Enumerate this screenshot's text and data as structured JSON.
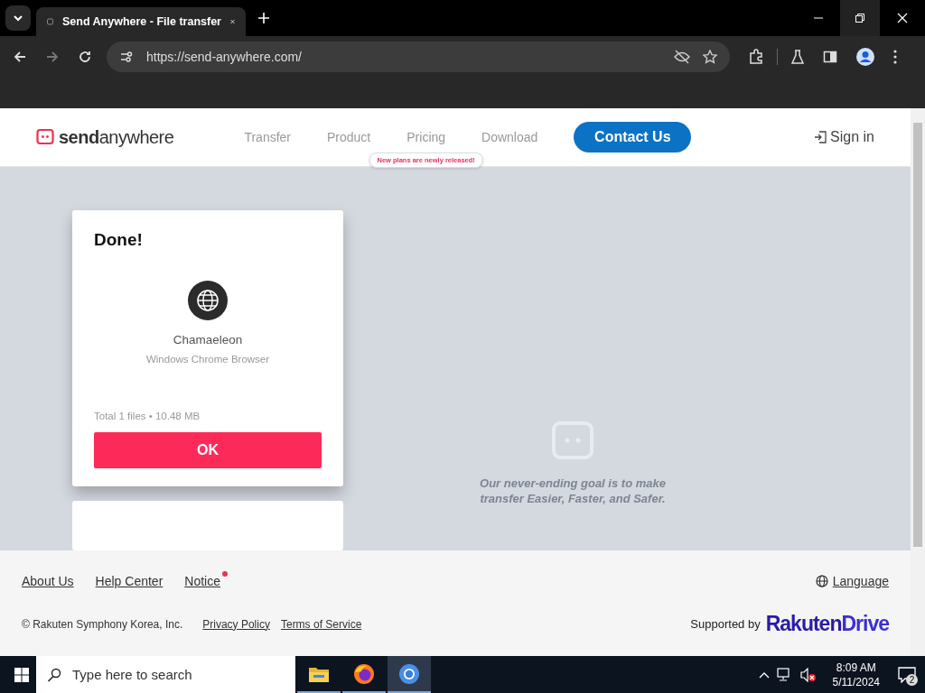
{
  "browser": {
    "tab_title": "Send Anywhere - File transfer",
    "url": "https://send-anywhere.com/"
  },
  "header": {
    "logo_bold": "send",
    "logo_rest": "anywhere",
    "nav": [
      {
        "label": "Transfer"
      },
      {
        "label": "Product"
      },
      {
        "label": "Pricing"
      },
      {
        "label": "Download"
      }
    ],
    "nav_tooltip": "New plans are newly released!",
    "contact": "Contact Us",
    "sign_in": "Sign in"
  },
  "card": {
    "title": "Done!",
    "device_name": "Chamaeleon",
    "device_desc": "Windows Chrome Browser",
    "total": "Total 1 files • 10.48 MB",
    "ok": "OK"
  },
  "slogan": [
    "Our never-ending goal is to make",
    "transfer Easier, Faster, and Safer."
  ],
  "footer": {
    "links": [
      {
        "label": "About Us",
        "badge": false
      },
      {
        "label": "Help Center",
        "badge": false
      },
      {
        "label": "Notice",
        "badge": true
      }
    ],
    "language": "Language",
    "copyright": "© Rakuten Symphony Korea, Inc.",
    "legal": [
      "Privacy Policy",
      "Terms of Service"
    ],
    "supported_by": "Supported by",
    "brand_a": "Rakuten",
    "brand_b": "Drive"
  },
  "taskbar": {
    "search_placeholder": "Type here to search",
    "time": "8:09 AM",
    "date": "5/11/2024",
    "notifications": "2"
  }
}
